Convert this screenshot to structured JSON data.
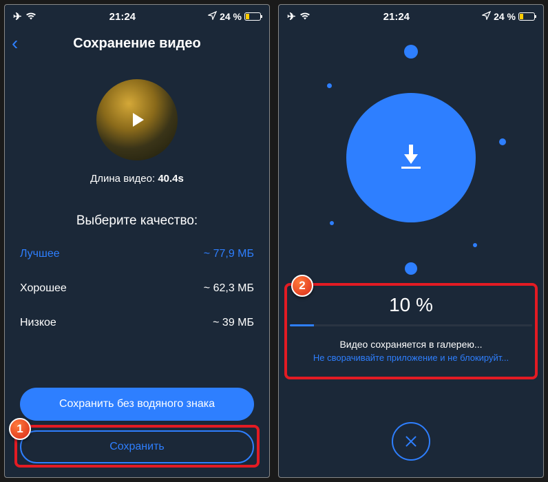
{
  "status": {
    "time": "21:24",
    "battery_pct": "24 %"
  },
  "left": {
    "title": "Сохранение видео",
    "length_label": "Длина видео:",
    "length_value": "40.4s",
    "quality_header": "Выберите качество:",
    "quality": [
      {
        "label": "Лучшее",
        "size": "~ 77,9 МБ",
        "selected": true
      },
      {
        "label": "Хорошее",
        "size": "~ 62,3 МБ",
        "selected": false
      },
      {
        "label": "Низкое",
        "size": "~ 39 МБ",
        "selected": false
      }
    ],
    "btn_nowm": "Сохранить без водяного знака",
    "btn_save": "Сохранить"
  },
  "right": {
    "percent": "10 %",
    "progress_value": 10,
    "saving": "Видео сохраняется в галерею...",
    "warning": "Не сворачивайте приложение и не блокируйт..."
  },
  "badges": {
    "one": "1",
    "two": "2"
  }
}
